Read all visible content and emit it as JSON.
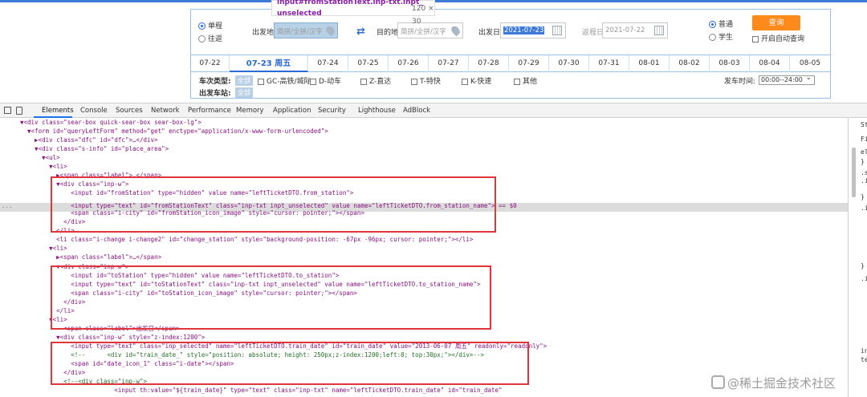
{
  "tooltip": {
    "text_line1": "input#fromStationText.inp-txt.inpt_",
    "text_line2": "unselected",
    "size": "120 × 30"
  },
  "search": {
    "trip_type": [
      "单程",
      "往返"
    ],
    "from_label": "出发地",
    "from_placeholder": "简拼/全拼/汉字",
    "to_label": "目的地",
    "to_placeholder": "简拼/全拼/汉字",
    "depart_label": "出发日",
    "depart_value": "2021-07-23",
    "return_label": "返程日",
    "return_value": "2021-07-22",
    "passenger": [
      "普通",
      "学生"
    ],
    "query_button": "查询",
    "auto_query": "开启自动查询"
  },
  "dates": [
    "07-22",
    "07-23 周五",
    "07-24",
    "07-25",
    "07-26",
    "07-27",
    "07-28",
    "07-29",
    "07-30",
    "07-31",
    "08-01",
    "08-02",
    "08-03",
    "08-04",
    "08-05"
  ],
  "filters": {
    "train_type_label": "车次类型:",
    "all_tag": "全部",
    "types": [
      "GC-高铁/城际",
      "D-动车",
      "Z-直达",
      "T-特快",
      "K-快速",
      "其他"
    ],
    "depart_station_label": "出发车站:",
    "depart_time_label": "发车时间:",
    "depart_time_value": "00:00--24:00"
  },
  "devtools": {
    "tabs": [
      "Elements",
      "Console",
      "Sources",
      "Network",
      "Performance",
      "Memory",
      "Application",
      "Security",
      "Lighthouse",
      "AdBlock"
    ],
    "side_fragments": [
      "St",
      "Fil",
      "ele",
      "}",
      ".s",
      ".i",
      "}",
      ".i",
      "}",
      ".i",
      "in",
      "te"
    ],
    "lines": [
      "▼<div class=\"sear-box quick-sear-box sear-box-lg\">",
      "  ▼<form id=\"queryLeftForm\" method=\"get\" enctype=\"application/x-www-form-urlencoded\">",
      "    ▶<div class=\"dfc\" id=\"dfc\">…</div>",
      "    ▼<div class=\"s-info\" id=\"place_area\">",
      "      ▼<ul>",
      "        ▼<li>",
      "          ▶<span class=\"label\">…</span>",
      "          ▼<div class=\"inp-w\">",
      "              <input id=\"fromStation\" type=\"hidden\" value name=\"leftTicketDTO.from_station\">",
      "              <input type=\"text\" id=\"fromStationText\" class=\"inp-txt inpt_unselected\" value name=\"leftTicketDTO.from_station_name\"> == $0",
      "              <span class=\"i-city\" id=\"fromStation_icon_image\" style=\"cursor: pointer;\"></span>",
      "            </div>",
      "          </li>",
      "          <li class=\"i-change i-change2\" id=\"change_station\" style=\"background-position: -67px -96px; cursor: pointer;\"></li>",
      "        ▼<li>",
      "          ▶<span class=\"label\">…</span>",
      "          ▼<div class=\"inp-w\">",
      "              <input id=\"toStation\" type=\"hidden\" value name=\"leftTicketDTO.to_station\">",
      "              <input type=\"text\" id=\"toStationText\" class=\"inp-txt inpt_unselected\" value name=\"leftTicketDTO.to_station_name\">",
      "              <span class=\"i-city\" id=\"toStation_icon_image\" style=\"cursor: pointer;\"></span>",
      "            </div>",
      "          </li>",
      "        ▼<li>",
      "            <span class=\"label\">出发日</span>",
      "          ▼<div class=\"inp-w\" style=\"z-index:1200\">",
      "              <input type=\"text\" class=\"inp_selected\" name=\"leftTicketDTO.train_date\" id=\"train_date\" value=\"2013-06-07 周五\" readonly=\"readonly\">",
      "              <!--      <div id=\"train_date_\" style=\"position: absolute; height: 250px;z-index:1200;left:0; top:30px;\"></div>-->",
      "              <span id=\"date_icon_1\" class=\"i-date\"></span>",
      "            </div>",
      "            <!--<div class=\"inp-w\">",
      "                          <input th:value=\"${train_date}\" type=\"text\" class=\"inp-txt\" name=\"leftTicketDTO.train_date\" id=\"train_date\""
    ]
  },
  "watermark": "@稀土掘金技术社区"
}
